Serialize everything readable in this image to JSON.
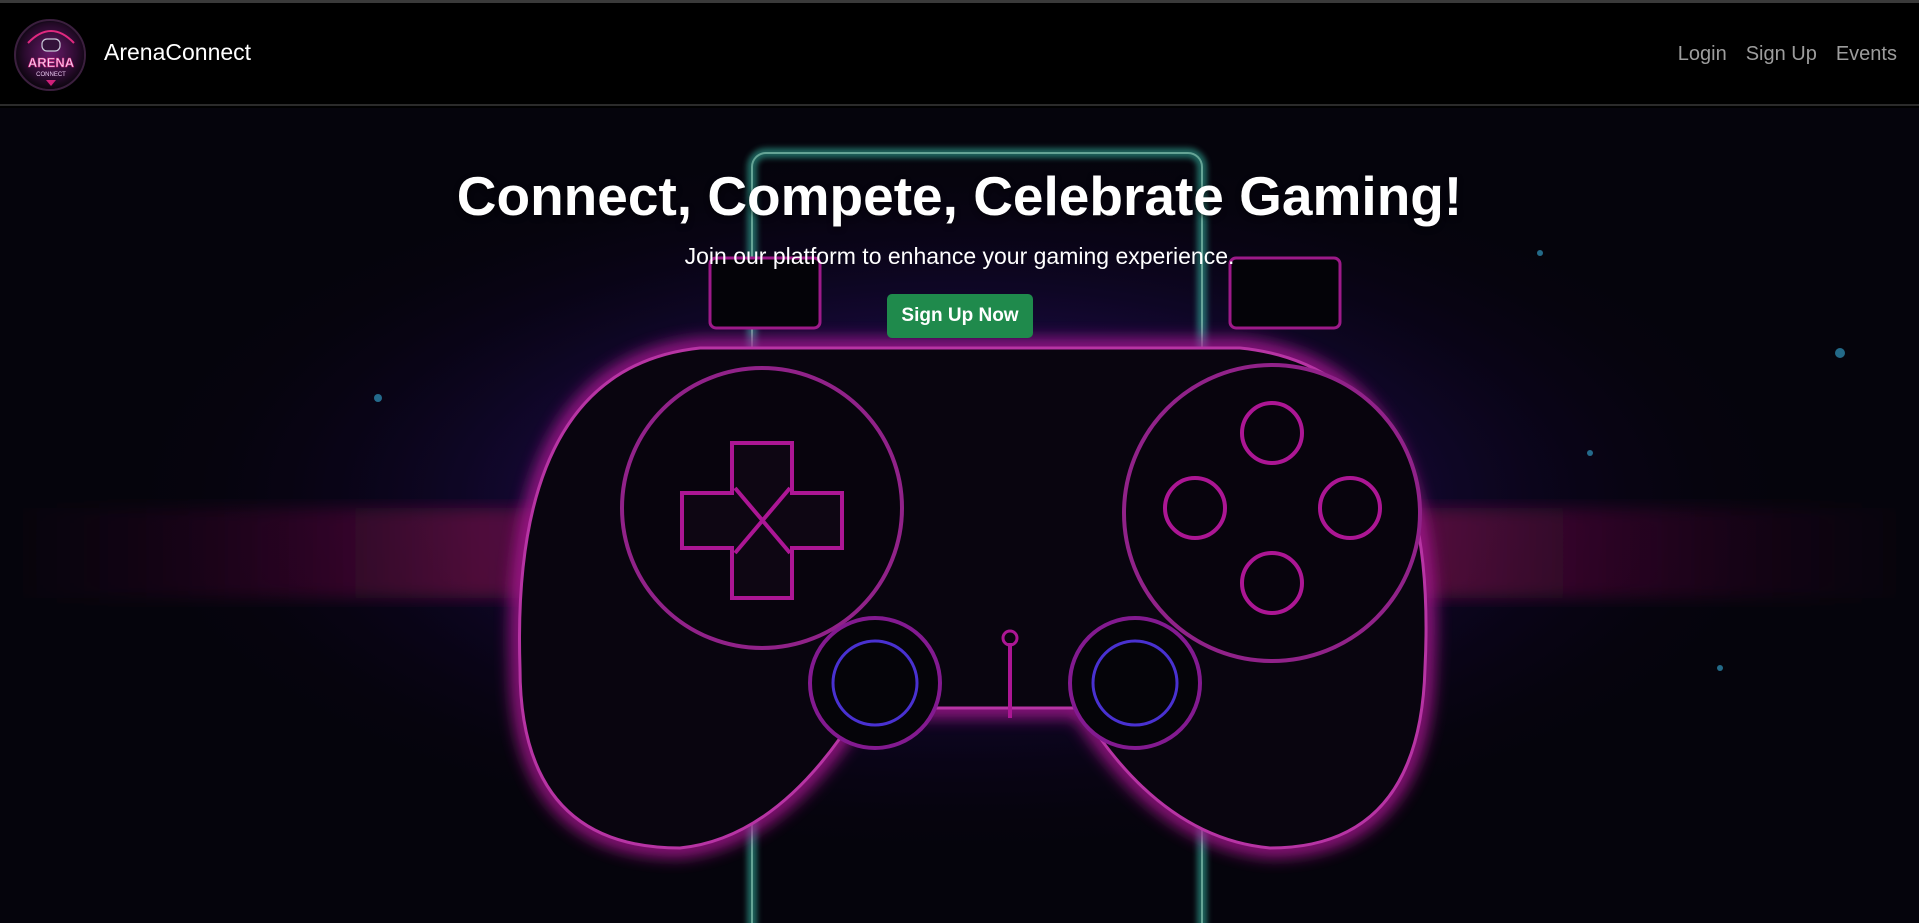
{
  "brand": {
    "name": "ArenaConnect",
    "logo_icon": "arena-connect-logo",
    "logo_text_top": "ARENA",
    "logo_text_bottom": "CONNECT"
  },
  "nav": {
    "items": [
      {
        "label": "Login"
      },
      {
        "label": "Sign Up"
      },
      {
        "label": "Events"
      }
    ]
  },
  "hero": {
    "title": "Connect, Compete, Celebrate Gaming!",
    "subtitle": "Join our platform to enhance your gaming experience.",
    "cta_label": "Sign Up Now",
    "background_image": "neon-gamepad-icon"
  },
  "colors": {
    "navbar_bg": "#000000",
    "nav_link": "#9d9d9d",
    "cta_bg": "#1f8a4c",
    "neon_pink": "#d21bb5",
    "neon_blue": "#4a3cff",
    "neon_cyan": "#3fe0c8"
  }
}
